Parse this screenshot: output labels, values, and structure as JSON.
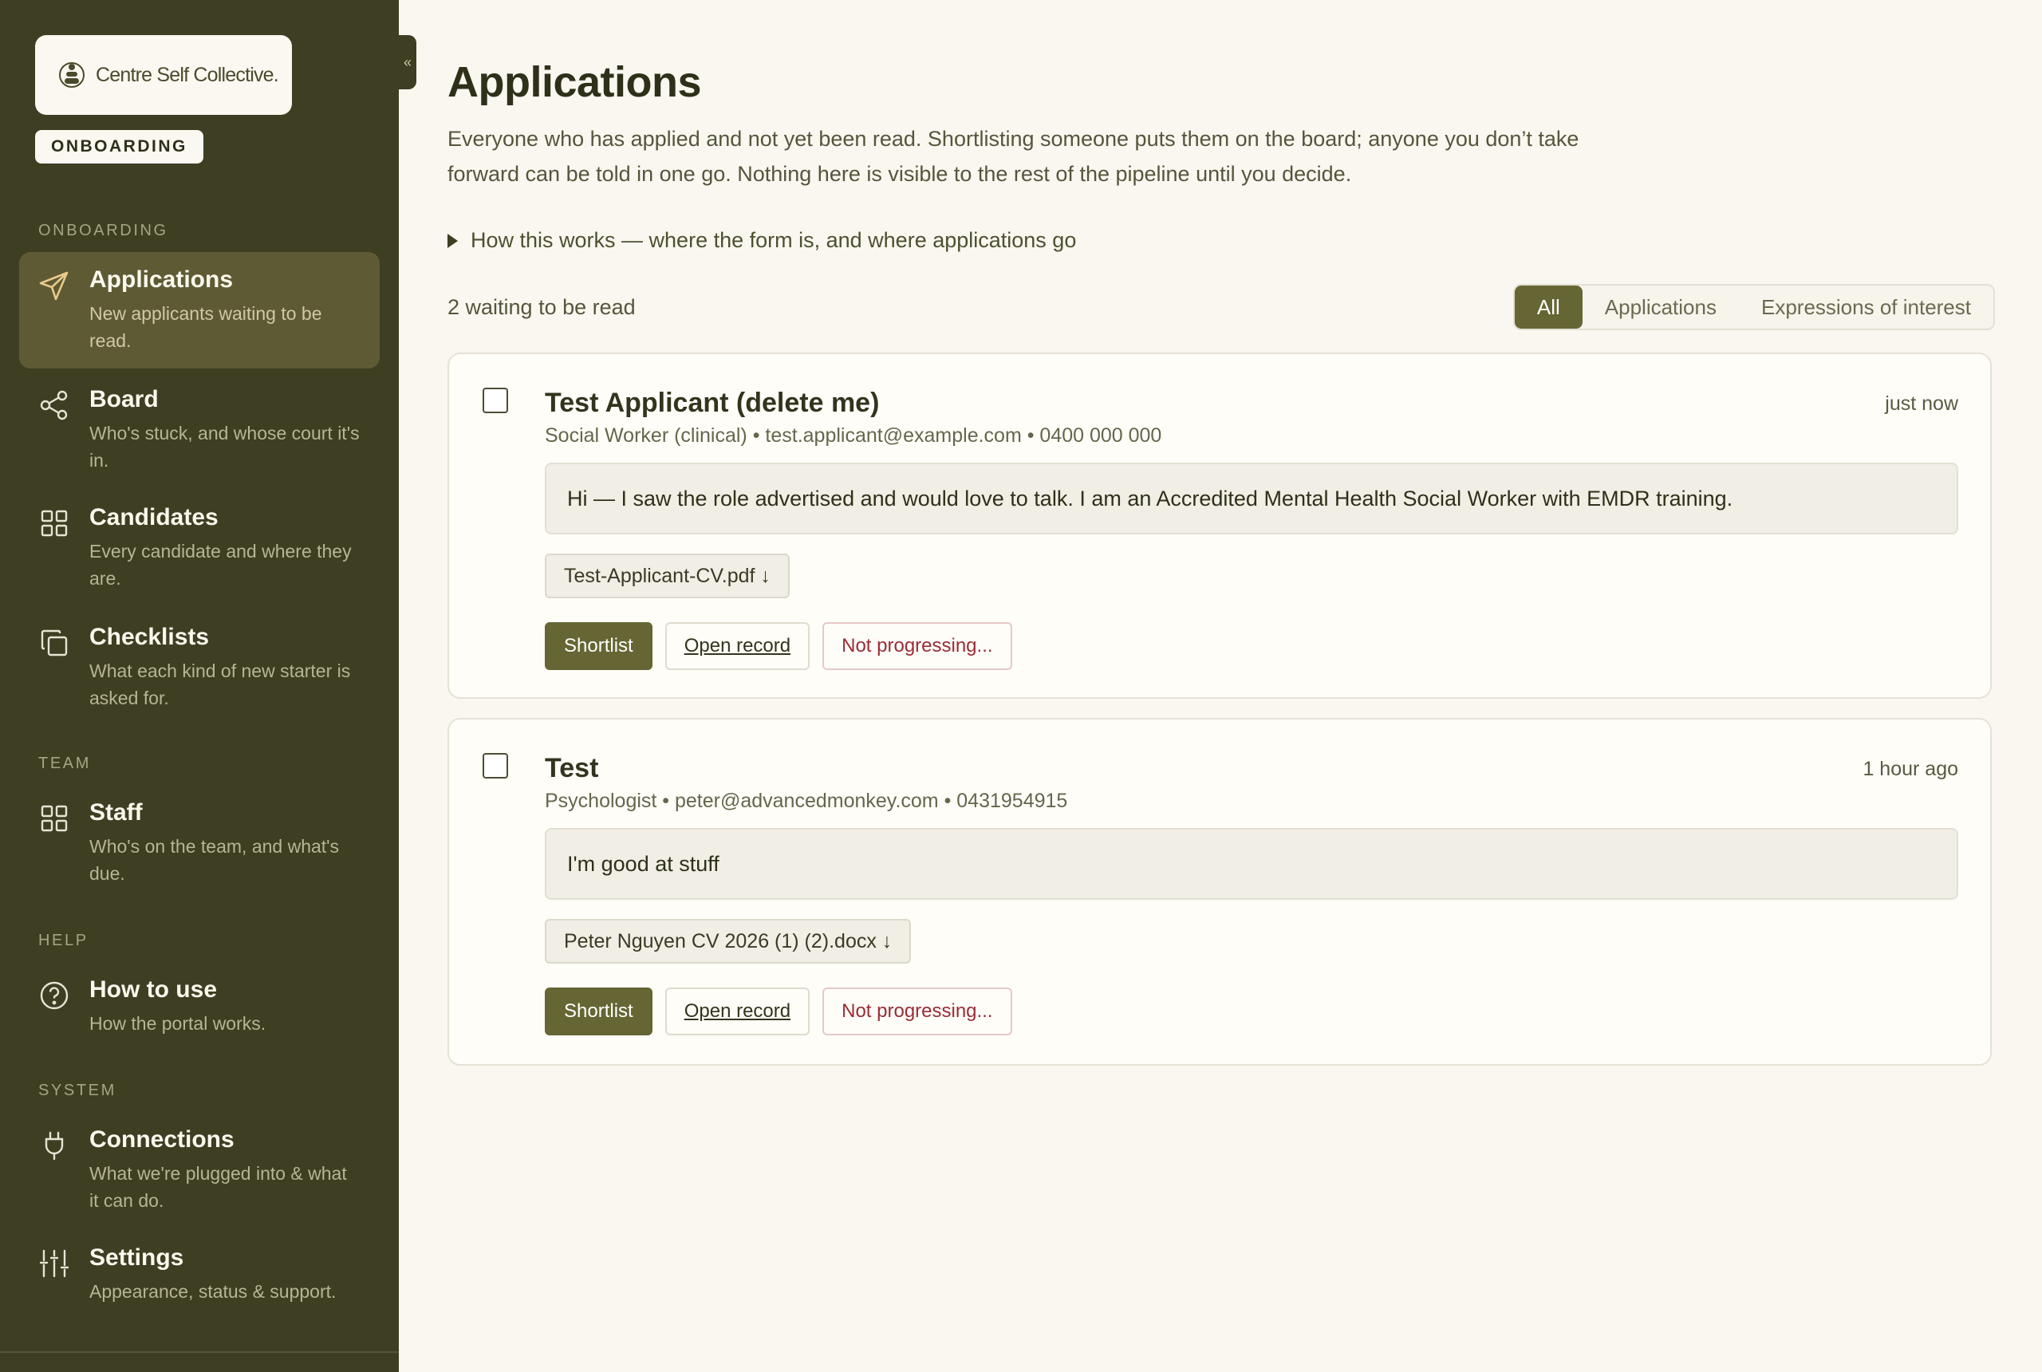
{
  "sidebar": {
    "logo_text": "Centre Self Collective.",
    "mode_badge": "ONBOARDING",
    "collapse_glyph": "«",
    "sections": {
      "onboarding": "ONBOARDING",
      "team": "TEAM",
      "help": "HELP",
      "system": "SYSTEM"
    },
    "items": [
      {
        "label": "Applications",
        "desc": "New applicants waiting to be read.",
        "icon": "send-icon",
        "active": true
      },
      {
        "label": "Board",
        "desc": "Who's stuck, and whose court it's in.",
        "icon": "share-icon"
      },
      {
        "label": "Candidates",
        "desc": "Every candidate and where they are.",
        "icon": "grid-icon"
      },
      {
        "label": "Checklists",
        "desc": "What each kind of new starter is asked for.",
        "icon": "copy-icon"
      },
      {
        "label": "Staff",
        "desc": "Who's on the team, and what's due.",
        "icon": "grid-icon"
      },
      {
        "label": "How to use",
        "desc": "How the portal works.",
        "icon": "help-circle-icon"
      },
      {
        "label": "Connections",
        "desc": "What we're plugged into & what it can do.",
        "icon": "plug-icon"
      },
      {
        "label": "Settings",
        "desc": "Appearance, status & support.",
        "icon": "sliders-icon"
      }
    ]
  },
  "main": {
    "title": "Applications",
    "intro": "Everyone who has applied and not yet been read. Shortlisting someone puts them on the board; anyone you don’t take forward can be told in one go. Nothing here is visible to the rest of the pipeline until you decide.",
    "how_it_works": "How this works — where the form is, and where applications go",
    "waiting_count": "2 waiting to be read",
    "filters": [
      "All",
      "Applications",
      "Expressions of interest"
    ],
    "active_filter": "All",
    "applications": [
      {
        "name": "Test Applicant (delete me)",
        "time": "just now",
        "meta": "Social Worker (clinical) • test.applicant@example.com • 0400 000 000",
        "message": "Hi — I saw the role advertised and would love to talk. I am an Accredited Mental Health Social Worker with EMDR training.",
        "attachment": "Test-Applicant-CV.pdf ↓"
      },
      {
        "name": "Test",
        "time": "1 hour ago",
        "meta": "Psychologist • peter@advancedmonkey.com • 0431954915",
        "message": "I'm good at stuff",
        "attachment": "Peter Nguyen CV 2026 (1) (2).docx ↓"
      }
    ],
    "actions": {
      "shortlist": "Shortlist",
      "open_record": "Open record",
      "not_progressing": "Not progressing..."
    }
  },
  "colors": {
    "sidebar_bg": "#3d3e22",
    "accent": "#656633",
    "page_bg": "#faf7f0",
    "danger": "#9b2c35"
  }
}
